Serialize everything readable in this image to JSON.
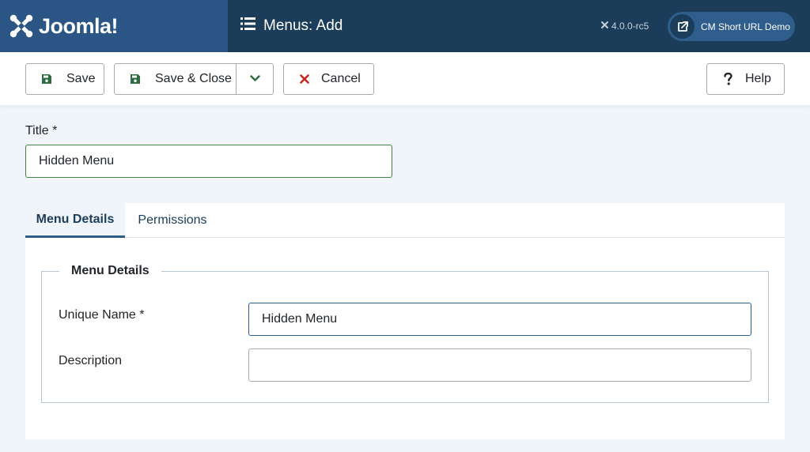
{
  "header": {
    "brand_name": "Joomla!",
    "page_title": "Menus: Add",
    "version": "4.0.0-rc5",
    "site_link_label": "CM Short URL Demo",
    "icons": [
      "joomla-logo-icon",
      "list-icon",
      "joomla-mini-icon",
      "external-link-icon"
    ]
  },
  "toolbar": {
    "save_label": "Save",
    "save_close_label": "Save & Close",
    "cancel_label": "Cancel",
    "help_label": "Help"
  },
  "form": {
    "title_label": "Title *",
    "title_value": "Hidden Menu",
    "tabs": [
      {
        "label": "Menu Details",
        "active": true
      },
      {
        "label": "Permissions",
        "active": false
      }
    ],
    "fieldset_legend": "Menu Details",
    "unique_name_label": "Unique Name *",
    "unique_name_value": "Hidden Menu",
    "description_label": "Description",
    "description_value": ""
  },
  "colors": {
    "header_bg": "#1c3d5a",
    "brand_bg": "#2a5585",
    "accent": "#2f5d8c",
    "save_icon": "#2e6b3e",
    "cancel_icon": "#c52827",
    "title_border": "#448344"
  }
}
